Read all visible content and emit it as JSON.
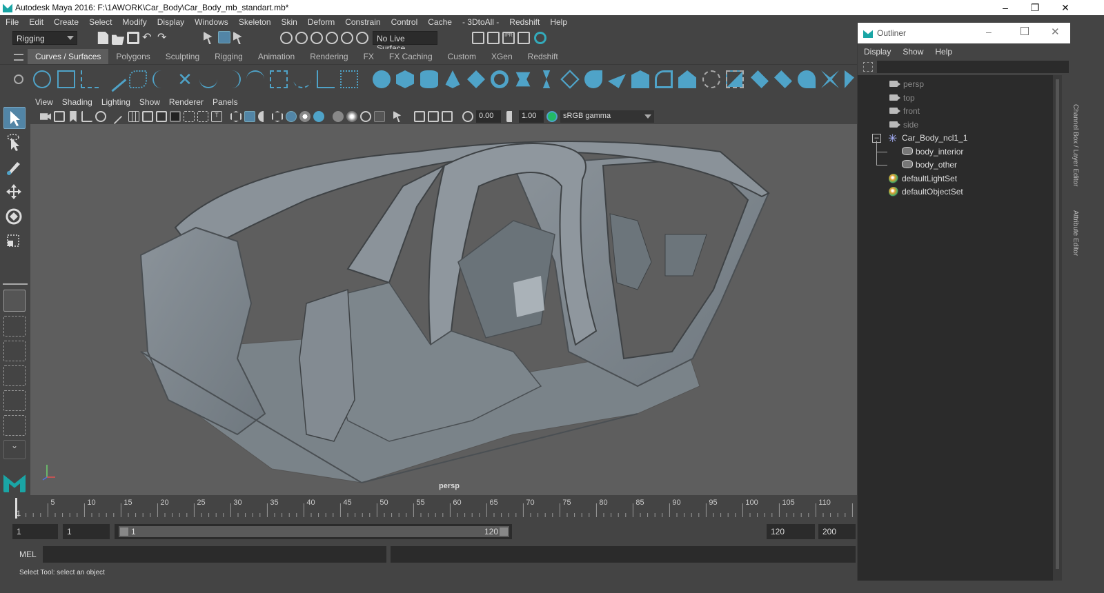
{
  "window": {
    "title": "Autodesk Maya 2016: F:\\1AWORK\\Car_Body\\Car_Body_mb_standart.mb*"
  },
  "menubar": [
    "File",
    "Edit",
    "Create",
    "Select",
    "Modify",
    "Display",
    "Windows",
    "Skeleton",
    "Skin",
    "Deform",
    "Constrain",
    "Control",
    "Cache",
    "- 3DtoAll -",
    "Redshift",
    "Help"
  ],
  "status_line": {
    "menu_set": "Rigging",
    "live_surface": "No Live Surface"
  },
  "shelf_tabs": [
    "Curves / Surfaces",
    "Polygons",
    "Sculpting",
    "Rigging",
    "Animation",
    "Rendering",
    "FX",
    "FX Caching",
    "Custom",
    "XGen",
    "Redshift"
  ],
  "active_shelf_tab": "Curves / Surfaces",
  "panel_menu": [
    "View",
    "Shading",
    "Lighting",
    "Show",
    "Renderer",
    "Panels"
  ],
  "panel_toolbar": {
    "exposure": "0.00",
    "gamma": "1.00",
    "color_space": "sRGB gamma"
  },
  "viewport": {
    "camera_label": "persp"
  },
  "timeline": {
    "ticks": [
      "1",
      "5",
      "10",
      "15",
      "20",
      "25",
      "30",
      "35",
      "40",
      "45",
      "50",
      "55",
      "60",
      "65",
      "70",
      "75",
      "80",
      "85",
      "90",
      "95",
      "100",
      "105",
      "110",
      "11"
    ],
    "current_frame": "1"
  },
  "range": {
    "start_frame": "1",
    "playback_start": "1",
    "range_start_label": "1",
    "range_end_label": "120",
    "playback_end": "120",
    "end_frame": "200"
  },
  "command_line": {
    "label": "MEL"
  },
  "help_line": "Select Tool: select an object",
  "outliner": {
    "title": "Outliner",
    "menu": [
      "Display",
      "Show",
      "Help"
    ],
    "items": [
      {
        "label": "persp",
        "type": "camera"
      },
      {
        "label": "top",
        "type": "camera"
      },
      {
        "label": "front",
        "type": "camera"
      },
      {
        "label": "side",
        "type": "camera"
      },
      {
        "label": "Car_Body_ncl1_1",
        "type": "group"
      },
      {
        "label": "body_interior",
        "type": "mesh"
      },
      {
        "label": "body_other",
        "type": "mesh"
      },
      {
        "label": "defaultLightSet",
        "type": "set"
      },
      {
        "label": "defaultObjectSet",
        "type": "set"
      }
    ]
  },
  "side_tabs": [
    "Channel Box / Layer Editor",
    "Attribute Editor"
  ],
  "colors": {
    "accent": "#5285a6",
    "ui_bg": "#444444",
    "viewport_bg": "#5e5e5e",
    "field_bg": "#2b2b2b"
  }
}
